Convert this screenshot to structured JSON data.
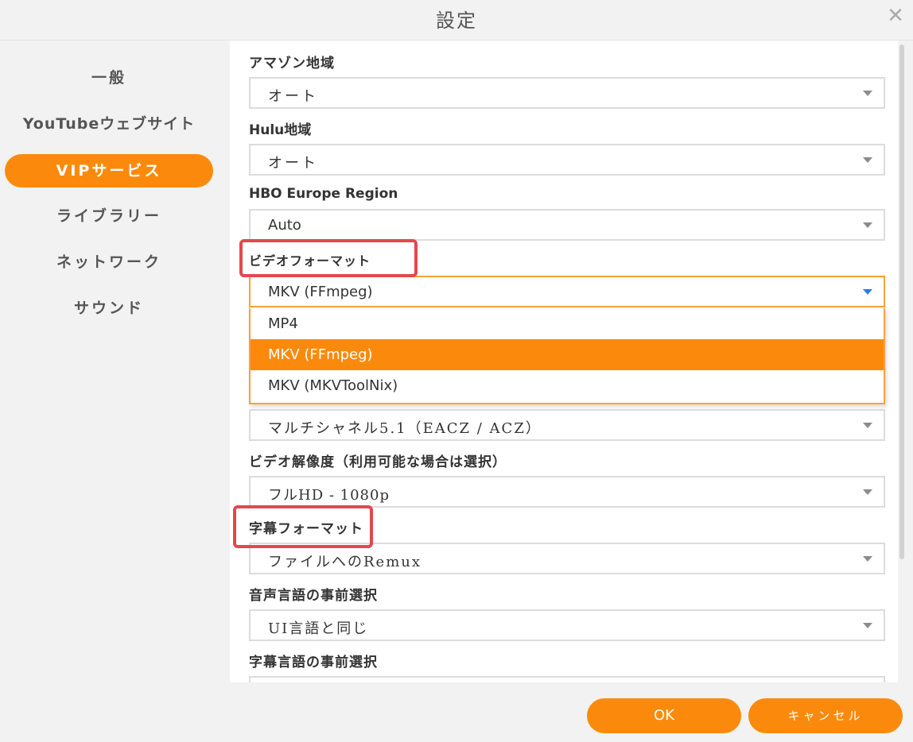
{
  "window": {
    "title": "設定"
  },
  "sidebar": {
    "items": [
      {
        "label": "一般"
      },
      {
        "label": "YouTubeウェブサイト"
      },
      {
        "label": "VIPサービス"
      },
      {
        "label": "ライブラリー"
      },
      {
        "label": "ネットワーク"
      },
      {
        "label": "サウンド"
      }
    ],
    "active_index": 2
  },
  "settings": {
    "amazon_region": {
      "label": "アマゾン地域",
      "value": "オート"
    },
    "hulu_region": {
      "label": "Hulu地域",
      "value": "オート"
    },
    "hbo_region": {
      "label": "HBO Europe Region",
      "value": "Auto"
    },
    "video_format": {
      "label": "ビデオフォーマット",
      "value": "MKV (FFmpeg)",
      "options": [
        "MP4",
        "MKV (FFmpeg)",
        "MKV (MKVToolNix)"
      ],
      "selected_index": 1
    },
    "audio_format": {
      "value": "マルチシャネル5.1（EACZ / ACZ）"
    },
    "video_resolution": {
      "label": "ビデオ解像度（利用可能な場合は選択）",
      "value": "フルHD - 1080p"
    },
    "subtitle_format": {
      "label": "字幕フォーマット",
      "value": "ファイルへのRemux"
    },
    "audio_language": {
      "label": "音声言語の事前選択",
      "value": "UI言語と同じ"
    },
    "subtitle_language": {
      "label": "字幕言語の事前選択"
    }
  },
  "footer": {
    "ok_label": "OK",
    "cancel_label": "キャンセル"
  },
  "colors": {
    "accent": "#fb8a0c",
    "highlight": "#e34850"
  }
}
